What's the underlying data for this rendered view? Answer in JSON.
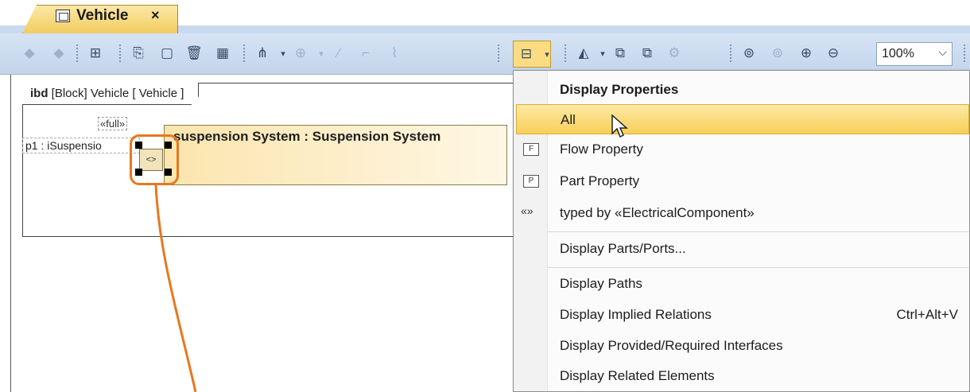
{
  "tab": {
    "title": "Vehicle",
    "close": "×"
  },
  "toolbar": {
    "zoom_value": "100%"
  },
  "diagram": {
    "frame_kind": "ibd",
    "frame_header_rest": "[Block] Vehicle [ Vehicle ]",
    "stereotype": "«full»",
    "port_label": "p1 : iSuspensio",
    "part_title": "suspension System : Suspension System",
    "port_glyph": "<>"
  },
  "menu": {
    "header": "Display Properties",
    "items": [
      {
        "label": "All",
        "icon": "",
        "selected": true
      },
      {
        "label": "Flow Property",
        "icon": "F"
      },
      {
        "label": "Part Property",
        "icon": "P"
      },
      {
        "label": "typed by «ElectricalComponent»",
        "icon": "«»"
      },
      {
        "label": "Display Parts/Ports..."
      },
      {
        "label": "Display Paths"
      },
      {
        "label": "Display Implied Relations",
        "shortcut": "Ctrl+Alt+V"
      },
      {
        "label": "Display Provided/Required Interfaces"
      },
      {
        "label": "Display Related Elements"
      }
    ]
  },
  "colors": {
    "highlight": "#e8781e",
    "menu_selected": "#f8cf57",
    "toolbar_bg": "#c3d5ec"
  }
}
